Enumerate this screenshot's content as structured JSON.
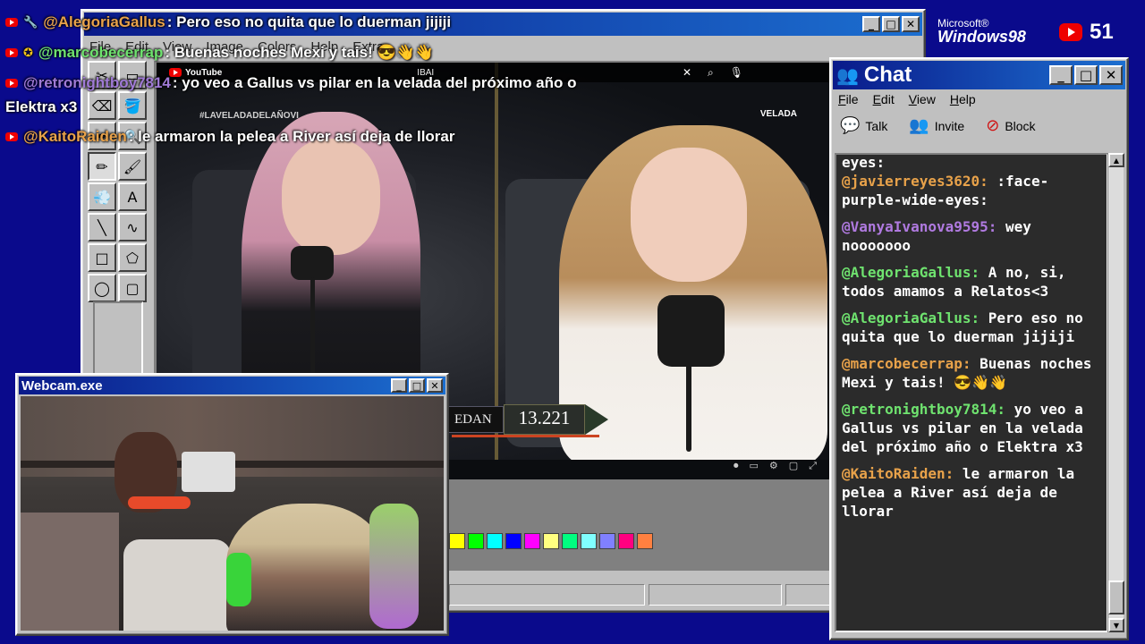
{
  "paint": {
    "title": "",
    "menu": [
      "File",
      "Edit",
      "View",
      "Image",
      "Colors",
      "Help",
      "Extras"
    ],
    "tools": [
      "✂",
      "▭",
      "⌫",
      "🪣",
      "✒",
      "🔍",
      "✏",
      "🖌",
      "💨",
      "A",
      "╲",
      "∿",
      "□",
      "⬠",
      "◯",
      "▢"
    ],
    "palette": [
      "#ffff00",
      "#00ff00",
      "#00ffff",
      "#0000ff",
      "#ff00ff",
      "#ffff80",
      "#00ff80",
      "#80ffff",
      "#8080ff",
      "#ff0080",
      "#ff8040"
    ]
  },
  "video": {
    "yt_label": "YouTube",
    "channel": "IBAI",
    "hashtag": "#LAVELADADELAÑOVI",
    "logo": "VELADA",
    "score_name": "EDAN",
    "score_count": "13.221",
    "icons": [
      "✕",
      "⌕",
      "🎙"
    ],
    "controls": [
      "⏺",
      "▭",
      "⚙",
      "▢",
      "⤢"
    ]
  },
  "overlay_chat": [
    {
      "user": "@AlegoriaGallus",
      "text": ": Pero eso no quita que lo duerman jijiji",
      "color": "#e8a24a",
      "badge": "🔧"
    },
    {
      "user": "@marcobecerrap",
      "text": ": Buenas noches Mexi y tais! 😎👋👋",
      "color": "#6fe36f",
      "badge": "✪"
    },
    {
      "user": "@retronightboy7814",
      "text": ": yo veo a Gallus vs pilar en la velada del próximo año o",
      "color": "#a07ad6",
      "badge": ""
    },
    {
      "user": "",
      "text": "Elektra x3",
      "color": "#ffffff",
      "badge": ""
    },
    {
      "user": "@KaitoRaiden",
      "text": ": le armaron la pelea a River así deja de llorar",
      "color": "#e8a24a",
      "badge": ""
    }
  ],
  "windows98": {
    "ms": "Microsoft®",
    "name": "Windows98"
  },
  "viewers": {
    "count": "51"
  },
  "chat_window": {
    "title": "Chat",
    "menu": [
      "File",
      "Edit",
      "View",
      "Help"
    ],
    "toolbar": [
      {
        "label": "Talk",
        "icon": "💬"
      },
      {
        "label": "Invite",
        "icon": "👥"
      },
      {
        "label": "Block",
        "icon": "⊘"
      }
    ],
    "top_fragment": "eyes:",
    "messages": [
      {
        "user": "@javierreyes3620:",
        "text": ":face-purple-wide-eyes:",
        "color": "#e8a24a"
      },
      {
        "user": "@VanyaIvanova9595:",
        "text": "wey nooooooo",
        "color": "#b07ae0"
      },
      {
        "user": "@AlegoriaGallus:",
        "text": "A no, si, todos amamos a Relatos<3",
        "color": "#6fe36f"
      },
      {
        "user": "@AlegoriaGallus:",
        "text": "Pero eso no quita que lo duerman jijiji",
        "color": "#6fe36f"
      },
      {
        "user": "@marcobecerrap:",
        "text": "Buenas noches Mexi y tais! 😎👋👋",
        "color": "#e8a24a"
      },
      {
        "user": "@retronightboy7814:",
        "text": "yo veo a Gallus vs pilar en la velada del próximo año o Elektra x3",
        "color": "#6fe36f"
      },
      {
        "user": "@KaitoRaiden:",
        "text": "le armaron la pelea a River así deja de llorar",
        "color": "#e8a24a"
      }
    ]
  },
  "webcam": {
    "title": "Webcam.exe"
  },
  "title_buttons": [
    "_",
    "□",
    "✕"
  ]
}
